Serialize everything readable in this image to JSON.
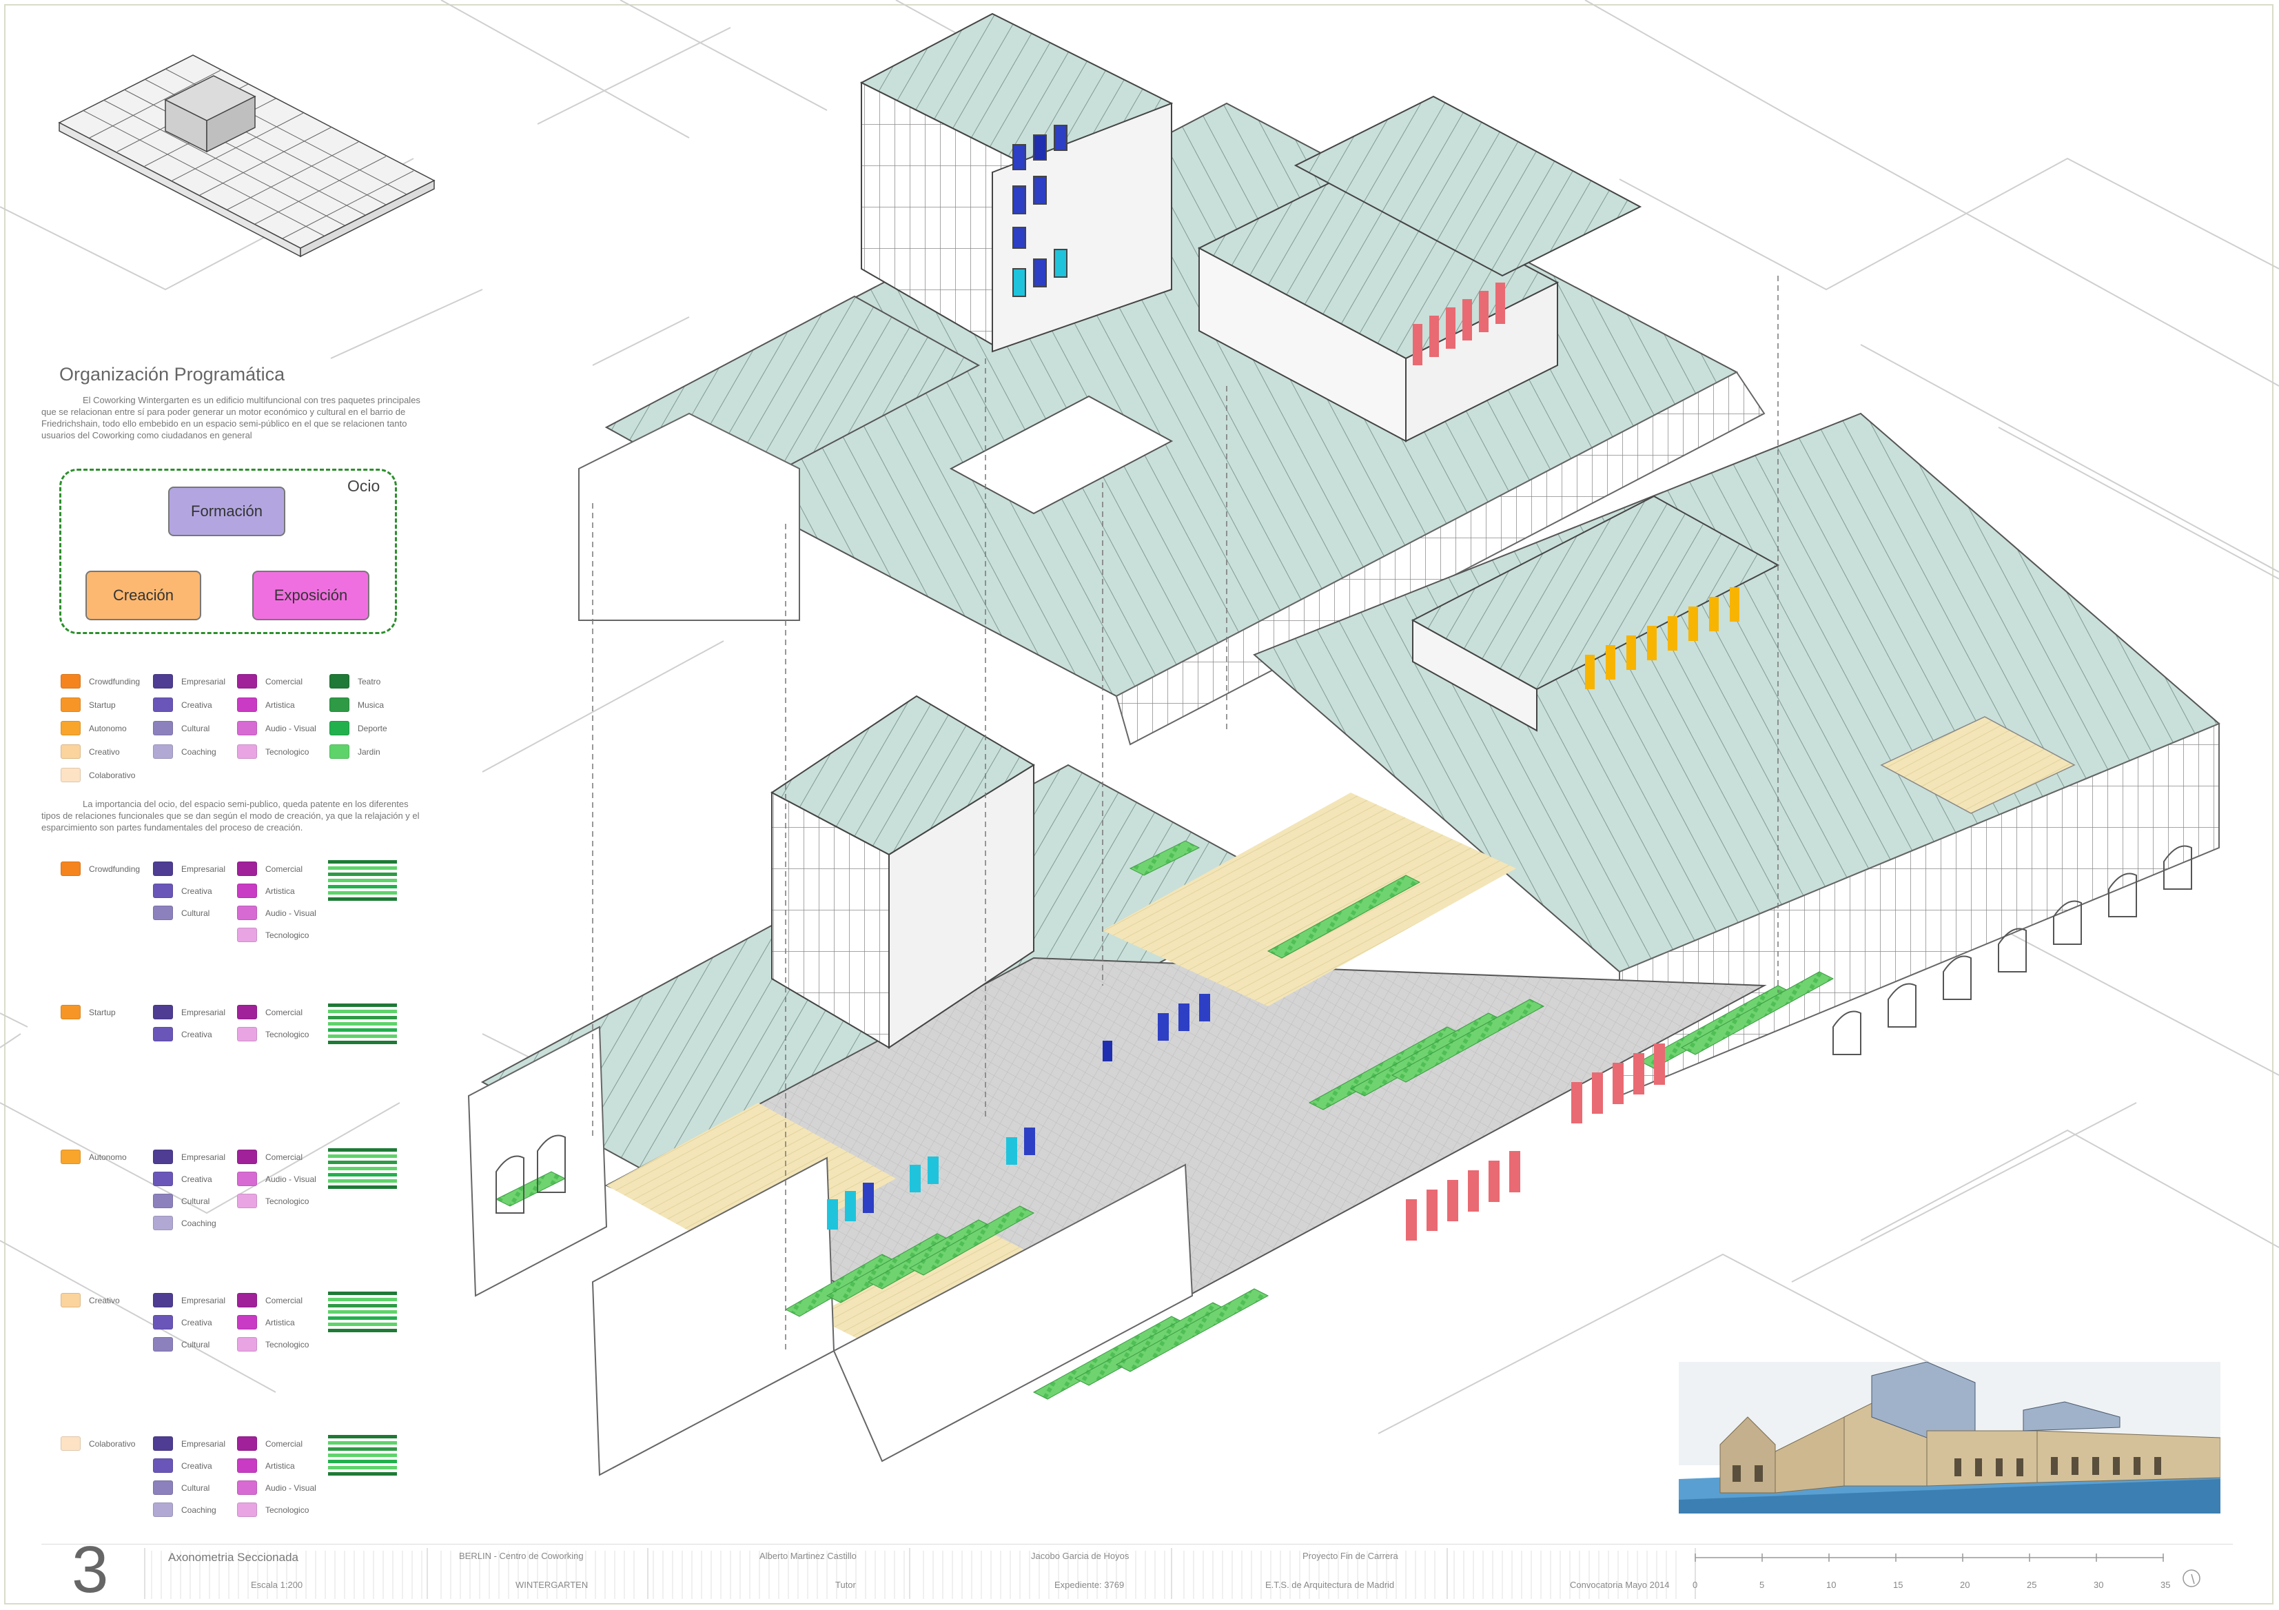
{
  "colors": {
    "roof": "#c7ddd7",
    "floor_yellow": "#f3e6b8",
    "floor_grey": "#d6d6d6",
    "garden": "#6fd36f",
    "red": "#e96a72",
    "blue": "#2d3fc4",
    "cyan": "#1fc4dc",
    "orange": "#f7b400",
    "line": "#555555"
  },
  "sidebar": {
    "heading": "Organización Programática",
    "intro": "El Coworking Wintergarten es un edificio multifuncional con tres paquetes principales que se relacionan entre sí para poder generar un motor económico y cultural en el barrio de Friedrichshain, todo ello embebido en un espacio semi-público en el que se relacionen tanto usuarios del Coworking como ciudadanos en general",
    "ocio_label": "Ocio",
    "program_boxes": [
      {
        "label": "Formación",
        "color": "#b3a6e0"
      },
      {
        "label": "Creación",
        "color": "#fcb870"
      },
      {
        "label": "Exposición",
        "color": "#f06fe0"
      }
    ],
    "legend": [
      {
        "label": "Crowdfunding",
        "color": "#f5841f"
      },
      {
        "label": "Startup",
        "color": "#f79626"
      },
      {
        "label": "Autonomo",
        "color": "#f9a52c"
      },
      {
        "label": "Creativo",
        "color": "#fbd39c"
      },
      {
        "label": "Colaborativo",
        "color": "#fde3c4"
      },
      {
        "label": "Empresarial",
        "color": "#4e3d92"
      },
      {
        "label": "Creativa",
        "color": "#6a56b8"
      },
      {
        "label": "Cultural",
        "color": "#8c81bd"
      },
      {
        "label": "Coaching",
        "color": "#b1a9d4"
      },
      {
        "label": "Comercial",
        "color": "#a0219a"
      },
      {
        "label": "Artistica",
        "color": "#c93bc4"
      },
      {
        "label": "Audio - Visual",
        "color": "#d86ad4"
      },
      {
        "label": "Tecnologico",
        "color": "#e9a4e4"
      },
      {
        "label": "Teatro",
        "color": "#1e7a36"
      },
      {
        "label": "Musica",
        "color": "#2e9a46"
      },
      {
        "label": "Deporte",
        "color": "#22b04d"
      },
      {
        "label": "Jardin",
        "color": "#5ed36a"
      }
    ],
    "intro2": "La importancia del ocio, del espacio semi-publico, queda patente en los diferentes tipos de relaciones funcionales que se dan según el modo de creación, ya que la relajación y el esparcimiento son partes fundamentales del proceso de creación.",
    "groups": [
      {
        "user": "Crowdfunding",
        "user_color": "#f5841f",
        "formacion": [
          [
            "Empresarial",
            "#4e3d92"
          ],
          [
            "Creativa",
            "#6a56b8"
          ],
          [
            "Cultural",
            "#8c81bd"
          ]
        ],
        "exposicion": [
          [
            "Comercial",
            "#a0219a"
          ],
          [
            "Artistica",
            "#c93bc4"
          ],
          [
            "Audio - Visual",
            "#d86ad4"
          ],
          [
            "Tecnologico",
            "#e9a4e4"
          ]
        ]
      },
      {
        "user": "Startup",
        "user_color": "#f79626",
        "formacion": [
          [
            "Empresarial",
            "#4e3d92"
          ],
          [
            "Creativa",
            "#6a56b8"
          ]
        ],
        "exposicion": [
          [
            "Comercial",
            "#a0219a"
          ],
          [
            "Tecnologico",
            "#e9a4e4"
          ]
        ]
      },
      {
        "user": "Autonomo",
        "user_color": "#f9a52c",
        "formacion": [
          [
            "Empresarial",
            "#4e3d92"
          ],
          [
            "Creativa",
            "#6a56b8"
          ],
          [
            "Cultural",
            "#8c81bd"
          ],
          [
            "Coaching",
            "#b1a9d4"
          ]
        ],
        "exposicion": [
          [
            "Comercial",
            "#a0219a"
          ],
          [
            "Audio - Visual",
            "#d86ad4"
          ],
          [
            "Tecnologico",
            "#e9a4e4"
          ]
        ]
      },
      {
        "user": "Creativo",
        "user_color": "#fbd39c",
        "formacion": [
          [
            "Empresarial",
            "#4e3d92"
          ],
          [
            "Creativa",
            "#6a56b8"
          ],
          [
            "Cultural",
            "#8c81bd"
          ]
        ],
        "exposicion": [
          [
            "Comercial",
            "#a0219a"
          ],
          [
            "Artistica",
            "#c93bc4"
          ],
          [
            "Tecnologico",
            "#e9a4e4"
          ]
        ]
      },
      {
        "user": "Colaborativo",
        "user_color": "#fde3c4",
        "formacion": [
          [
            "Empresarial",
            "#4e3d92"
          ],
          [
            "Creativa",
            "#6a56b8"
          ],
          [
            "Cultural",
            "#8c81bd"
          ],
          [
            "Coaching",
            "#b1a9d4"
          ]
        ],
        "exposicion": [
          [
            "Comercial",
            "#a0219a"
          ],
          [
            "Artistica",
            "#c93bc4"
          ],
          [
            "Audio - Visual",
            "#d86ad4"
          ],
          [
            "Tecnologico",
            "#e9a4e4"
          ]
        ]
      }
    ],
    "ocio_bar_colors": [
      "#1e7a36",
      "#5ed36a",
      "#2e9a46",
      "#5ed36a",
      "#22b04d",
      "#5ed36a",
      "#1e7a36"
    ]
  },
  "titleblock": {
    "sheet_number": "3",
    "title": "Axonometria Seccionada",
    "scale": "Escala 1:200",
    "project": "BERLIN - Centro de Coworking",
    "project_sub": "WINTERGARTEN",
    "author": "Alberto Martinez Castillo",
    "tutor_label": "Tutor",
    "tutor": "Jacobo Garcia de Hoyos",
    "expediente": "Expediente:   3769",
    "type": "Proyecto Fin de Carrera",
    "school": "E.T.S. de Arquitectura de Madrid",
    "convocatoria": "Convocatoria Mayo 2014",
    "scale_ticks": [
      "0",
      "5",
      "10",
      "15",
      "20",
      "25",
      "30",
      "35"
    ]
  }
}
